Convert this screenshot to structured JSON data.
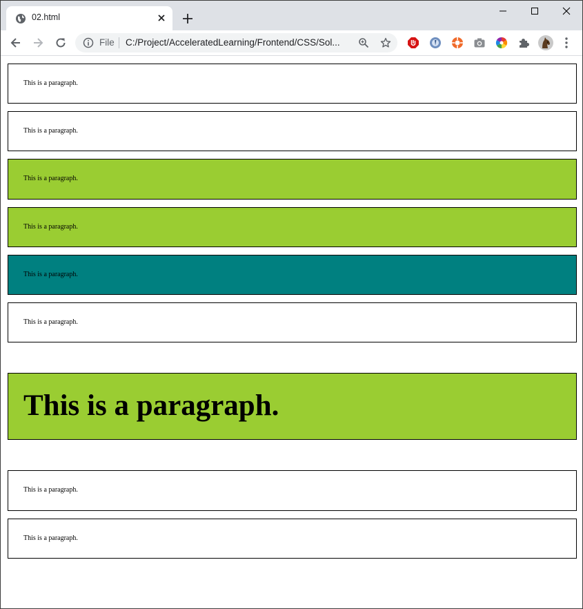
{
  "browser": {
    "tab": {
      "title": "02.html"
    },
    "omnibox": {
      "scheme_label": "File",
      "url": "C:/Project/AcceleratedLearning/Frontend/CSS/Sol..."
    }
  },
  "colors": {
    "white_box": "#ffffff",
    "green_box": "#9acd32",
    "teal_box": "#008080"
  },
  "page": {
    "paragraphs": [
      {
        "text": "This is a paragraph.",
        "background": "white",
        "size": "small"
      },
      {
        "text": "This is a paragraph.",
        "background": "white",
        "size": "small"
      },
      {
        "text": "This is a paragraph.",
        "background": "yellowgreen",
        "size": "small"
      },
      {
        "text": "This is a paragraph.",
        "background": "yellowgreen",
        "size": "small"
      },
      {
        "text": "This is a paragraph.",
        "background": "teal",
        "size": "small"
      },
      {
        "text": "This is a paragraph.",
        "background": "white",
        "size": "small"
      },
      {
        "text": "This is a paragraph.",
        "background": "yellowgreen",
        "size": "large"
      },
      {
        "text": "This is a paragraph.",
        "background": "white",
        "size": "small"
      },
      {
        "text": "This is a paragraph.",
        "background": "white",
        "size": "small"
      }
    ]
  }
}
